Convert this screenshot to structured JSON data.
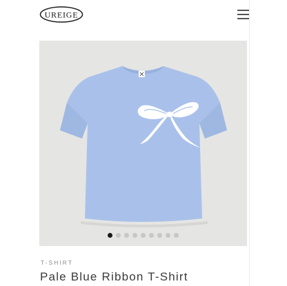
{
  "header": {
    "logo_text": "UREIGE",
    "menu_icon": "hamburger-menu-icon"
  },
  "gallery": {
    "image_alt": "Pale blue t-shirt with white ribbon bow print",
    "shirt_color": "#a9c1ea",
    "background_color": "#e5e5e3",
    "slide_count": 9,
    "active_slide": 1
  },
  "product": {
    "category": "T-SHIRT",
    "title": "Pale Blue Ribbon T-Shirt"
  }
}
